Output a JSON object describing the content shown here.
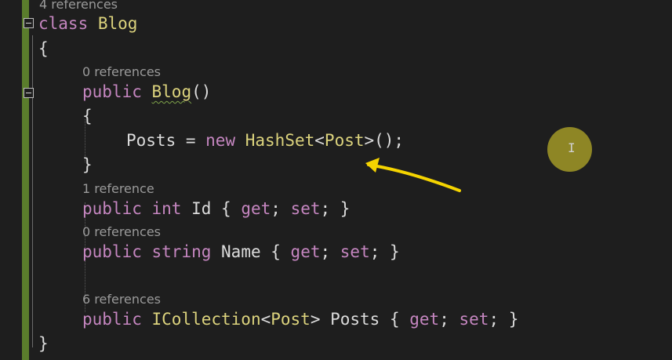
{
  "editor": {
    "lenses": {
      "class_refs": "4 references",
      "ctor_refs": "0 references",
      "id_refs": "1 reference",
      "name_refs": "0 references",
      "posts_refs": "6 references"
    },
    "lines": {
      "l1": [
        "class",
        "Blog"
      ],
      "l2": "{",
      "l3": [
        "public",
        "Blog",
        "()"
      ],
      "l4": "{",
      "l5": [
        "Posts",
        " = ",
        "new",
        "HashSet",
        "<",
        "Post",
        ">();"
      ],
      "l6": "}",
      "l7": [
        "public",
        "int",
        "Id { ",
        "get",
        "; ",
        "set",
        "; }"
      ],
      "l8": [
        "public",
        "string",
        "Name { ",
        "get",
        "; ",
        "set",
        "; }"
      ],
      "l9": [
        "public",
        "ICollection",
        "<",
        "Post",
        "> Posts { ",
        "get",
        "; ",
        "set",
        "; }"
      ],
      "l10": "}"
    }
  },
  "colors": {
    "background": "#1e1e1e",
    "keyword": "#c586c0",
    "type": "#dcd37d",
    "text": "#dcdcdc",
    "reference_lens": "#9a9a9a",
    "change_bar": "#5a7d2c",
    "annotation_arrow": "#f5d400",
    "cursor_highlight": "#b4aa28"
  },
  "icons": {
    "fold_toggle": "minus-box",
    "cursor": "text-ibeam"
  }
}
